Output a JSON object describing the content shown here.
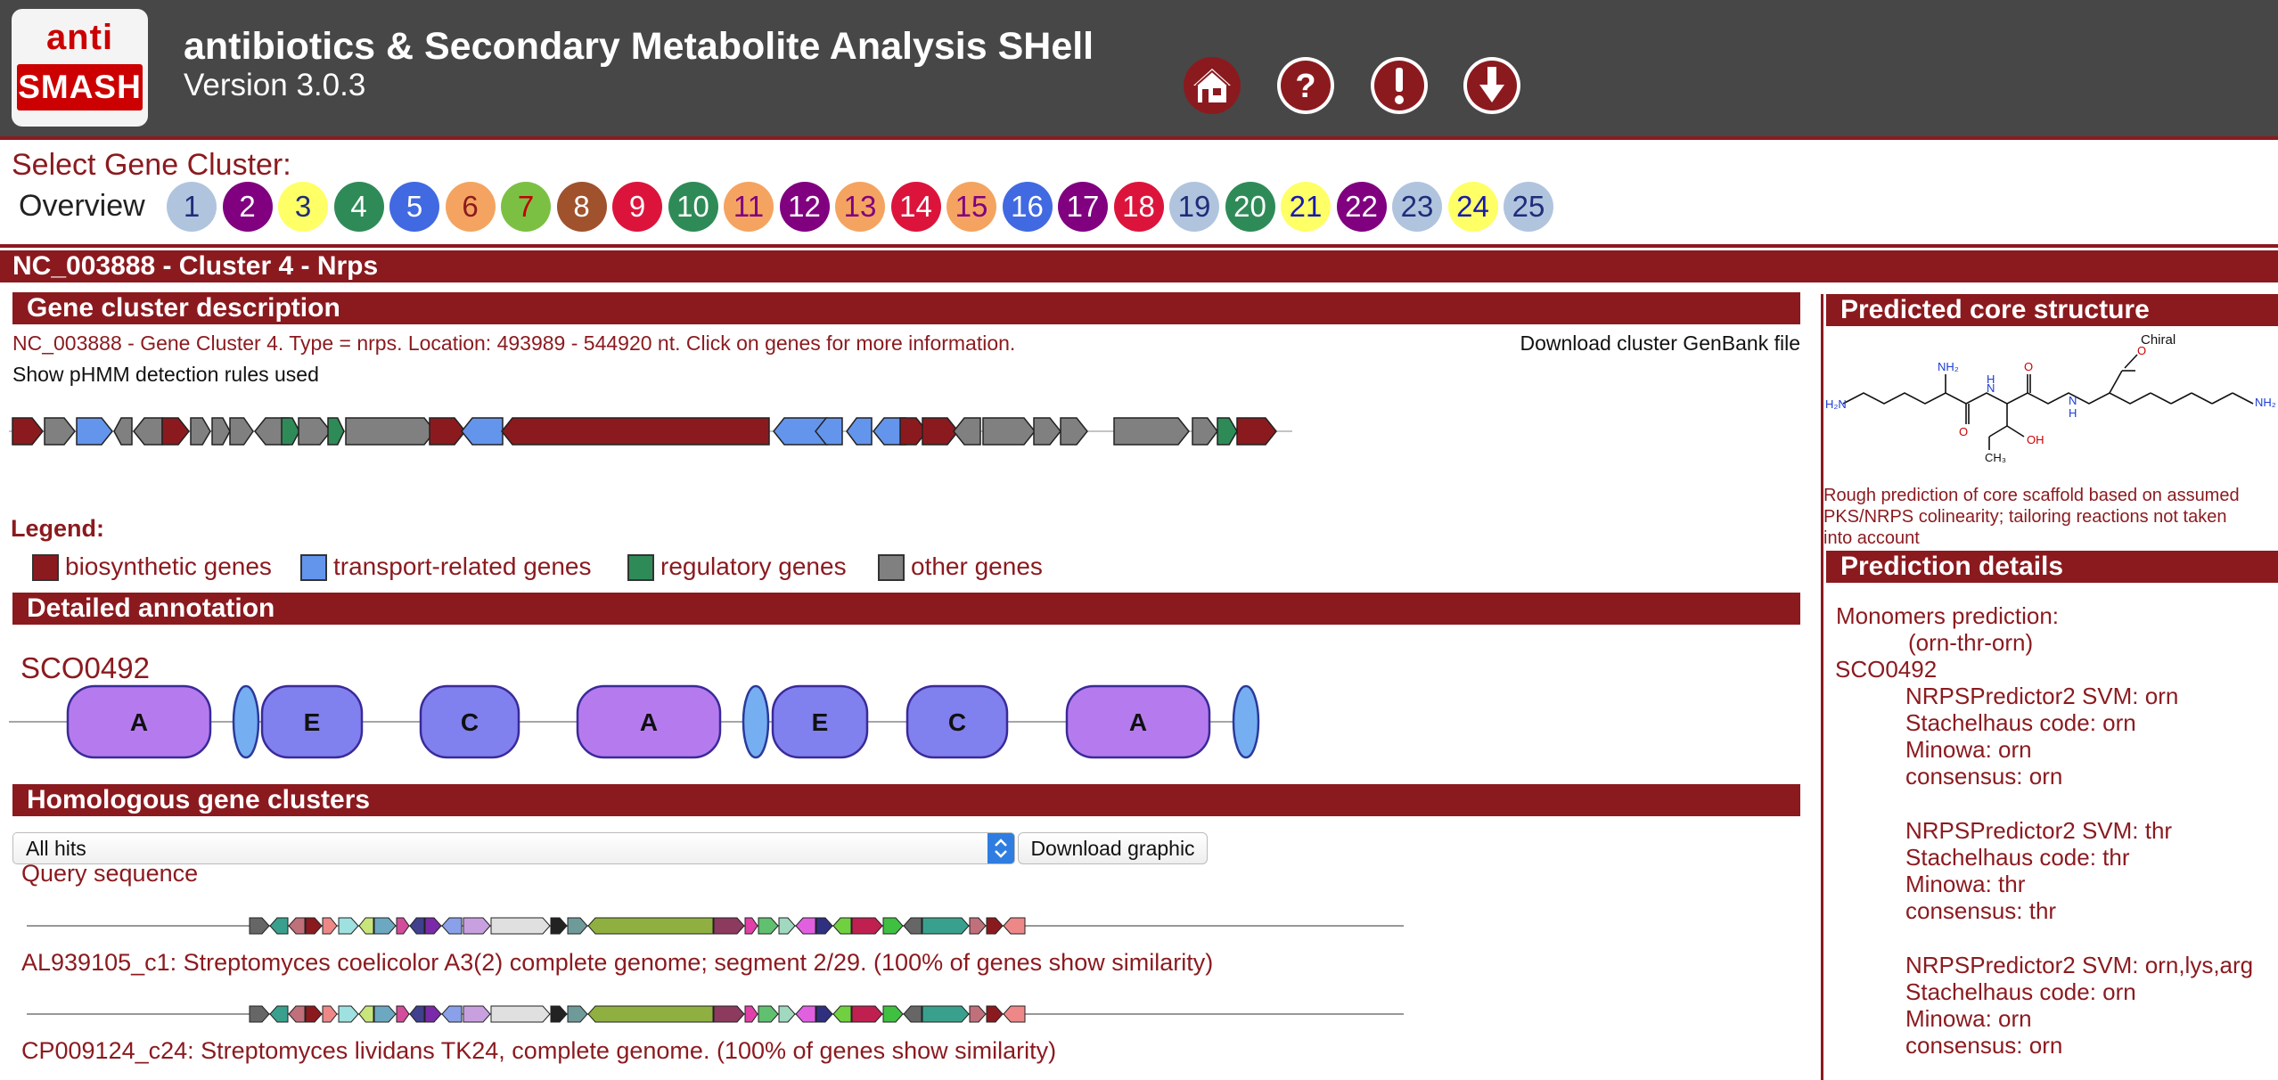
{
  "header": {
    "logo_top": "anti",
    "logo_bottom": "SMASH",
    "title": "antibiotics & Secondary Metabolite Analysis SHell",
    "version": "Version 3.0.3",
    "buttons": [
      "home-icon",
      "help-icon",
      "about-icon",
      "download-icon"
    ]
  },
  "selector": {
    "title": "Select Gene Cluster:",
    "overview_label": "Overview",
    "clusters": [
      {
        "label": "1",
        "bg": "#b0c4de",
        "fg": "#1f2d7a"
      },
      {
        "label": "2",
        "bg": "#800080",
        "fg": "#ffffff"
      },
      {
        "label": "3",
        "bg": "#ffff66",
        "fg": "#1f2d7a"
      },
      {
        "label": "4",
        "bg": "#2e8b57",
        "fg": "#ffffff"
      },
      {
        "label": "5",
        "bg": "#4169e1",
        "fg": "#ffffff"
      },
      {
        "label": "6",
        "bg": "#f4a460",
        "fg": "#8b1a1f"
      },
      {
        "label": "7",
        "bg": "#7bc043",
        "fg": "#c00000"
      },
      {
        "label": "8",
        "bg": "#a0522d",
        "fg": "#ffffff"
      },
      {
        "label": "9",
        "bg": "#dc143c",
        "fg": "#ffffff"
      },
      {
        "label": "10",
        "bg": "#2e8b57",
        "fg": "#ffffff"
      },
      {
        "label": "11",
        "bg": "#f4a460",
        "fg": "#800080"
      },
      {
        "label": "12",
        "bg": "#800080",
        "fg": "#ffffff"
      },
      {
        "label": "13",
        "bg": "#f4a460",
        "fg": "#800080"
      },
      {
        "label": "14",
        "bg": "#dc143c",
        "fg": "#ffffff"
      },
      {
        "label": "15",
        "bg": "#f4a460",
        "fg": "#800080"
      },
      {
        "label": "16",
        "bg": "#4169e1",
        "fg": "#ffffff"
      },
      {
        "label": "17",
        "bg": "#800080",
        "fg": "#ffffff"
      },
      {
        "label": "18",
        "bg": "#dc143c",
        "fg": "#ffffff"
      },
      {
        "label": "19",
        "bg": "#b0c4de",
        "fg": "#1f2d7a"
      },
      {
        "label": "20",
        "bg": "#2e8b57",
        "fg": "#ffffff"
      },
      {
        "label": "21",
        "bg": "#ffff66",
        "fg": "#1a1ab0"
      },
      {
        "label": "22",
        "bg": "#800080",
        "fg": "#ffffff"
      },
      {
        "label": "23",
        "bg": "#b0c4de",
        "fg": "#1f2d7a"
      },
      {
        "label": "24",
        "bg": "#ffff66",
        "fg": "#1a1ab0"
      },
      {
        "label": "25",
        "bg": "#b0c4de",
        "fg": "#1f2d7a"
      }
    ]
  },
  "cluster_bar": "NC_003888 - Cluster 4 - Nrps",
  "description": {
    "heading": "Gene cluster description",
    "summary": "NC_003888 - Gene Cluster 4. Type = nrps. Location: 493989 - 544920 nt. Click on genes for more information.",
    "download_link": "Download cluster GenBank file",
    "rules_link": "Show pHMM detection rules used",
    "genes": [
      {
        "dir": "+",
        "type": "biosynthetic"
      },
      {
        "dir": "+",
        "type": "other"
      },
      {
        "dir": "+",
        "type": "transport"
      },
      {
        "dir": "-",
        "type": "other"
      },
      {
        "dir": "-",
        "type": "other"
      },
      {
        "dir": "+",
        "type": "biosynthetic"
      },
      {
        "dir": "+",
        "type": "other"
      },
      {
        "dir": "+",
        "type": "other"
      },
      {
        "dir": "+",
        "type": "other"
      },
      {
        "dir": "-",
        "type": "other"
      },
      {
        "dir": "+",
        "type": "regulatory"
      },
      {
        "dir": "+",
        "type": "other"
      },
      {
        "dir": "+",
        "type": "regulatory"
      },
      {
        "dir": "+",
        "type": "other"
      },
      {
        "dir": "+",
        "type": "biosynthetic"
      },
      {
        "dir": "-",
        "type": "transport"
      },
      {
        "dir": "-",
        "type": "biosynthetic"
      },
      {
        "dir": "-",
        "type": "transport"
      },
      {
        "dir": "-",
        "type": "transport"
      },
      {
        "dir": "-",
        "type": "transport"
      },
      {
        "dir": "-",
        "type": "transport"
      },
      {
        "dir": "+",
        "type": "biosynthetic"
      },
      {
        "dir": "+",
        "type": "biosynthetic"
      },
      {
        "dir": "-",
        "type": "other"
      },
      {
        "dir": "+",
        "type": "other"
      },
      {
        "dir": "+",
        "type": "other"
      },
      {
        "dir": "+",
        "type": "other"
      },
      {
        "dir": "+",
        "type": "other"
      },
      {
        "dir": "+",
        "type": "other"
      },
      {
        "dir": "+",
        "type": "regulatory"
      },
      {
        "dir": "+",
        "type": "biosynthetic"
      }
    ],
    "legend_title": "Legend:",
    "legend": [
      {
        "label": "biosynthetic genes",
        "color": "#8b1a1f"
      },
      {
        "label": "transport-related genes",
        "color": "#6495ed"
      },
      {
        "label": "regulatory genes",
        "color": "#2e8b57"
      },
      {
        "label": "other genes",
        "color": "#808080"
      }
    ]
  },
  "annotation": {
    "heading": "Detailed annotation",
    "gene_name": "SCO0492",
    "domains": [
      {
        "label": "",
        "type": "pcp"
      },
      {
        "label": "A",
        "type": "A"
      },
      {
        "label": "",
        "type": "pcp"
      },
      {
        "label": "E",
        "type": "E"
      },
      {
        "label": "C",
        "type": "C"
      },
      {
        "label": "A",
        "type": "A"
      },
      {
        "label": "",
        "type": "pcp"
      },
      {
        "label": "E",
        "type": "E"
      },
      {
        "label": "C",
        "type": "C"
      },
      {
        "label": "A",
        "type": "A"
      },
      {
        "label": "",
        "type": "pcp"
      }
    ]
  },
  "homologous": {
    "heading": "Homologous gene clusters",
    "select_value": "All hits",
    "download_label": "Download graphic",
    "query_label": "Query sequence",
    "hits": [
      "AL939105_c1: Streptomyces coelicolor A3(2) complete genome; segment 2/29. (100% of genes show similarity)",
      "CP009124_c24: Streptomyces lividans TK24, complete genome. (100% of genes show similarity)"
    ]
  },
  "sidebar": {
    "structure_heading": "Predicted core structure",
    "chiral_label": "Chiral",
    "structure_caption": [
      "Rough prediction of core scaffold based on assumed",
      "PKS/NRPS colinearity; tailoring reactions not taken",
      "into account"
    ],
    "details_heading": "Prediction details",
    "monomers_label": "Monomers prediction:",
    "monomers_value": "(orn-thr-orn)",
    "gene": "SCO0492",
    "blocks": [
      [
        "NRPSPredictor2 SVM: orn",
        "Stachelhaus code: orn",
        "Minowa: orn",
        "consensus: orn"
      ],
      [
        "NRPSPredictor2 SVM: thr",
        "Stachelhaus code: thr",
        "Minowa: thr",
        "consensus: thr"
      ],
      [
        "NRPSPredictor2 SVM: orn,lys,arg",
        "Stachelhaus code: orn",
        "Minowa: orn",
        "consensus: orn"
      ]
    ]
  },
  "colors": {
    "brand_red": "#8b1a1f",
    "header_bg": "#474747"
  }
}
